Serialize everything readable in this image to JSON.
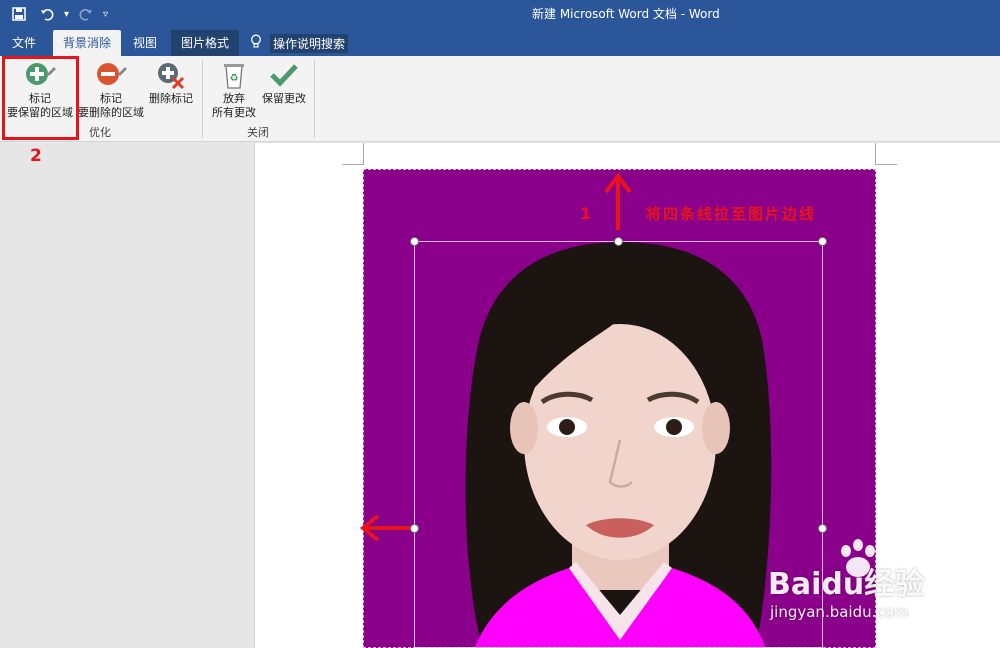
{
  "window": {
    "title": "新建 Microsoft Word 文档  -  Word"
  },
  "quick_access": [
    {
      "name": "save-icon",
      "glyph": "■"
    },
    {
      "name": "undo-icon",
      "glyph": "↶"
    },
    {
      "name": "redo-icon",
      "glyph": "↻"
    },
    {
      "name": "customize-icon",
      "glyph": "▾"
    }
  ],
  "tabs": {
    "file": "文件",
    "background_removal": "背景消除",
    "view": "视图",
    "picture_format": "图片格式"
  },
  "tell_me": {
    "label": "操作说明搜索"
  },
  "ribbon": {
    "keep_line1": "标记",
    "keep_line2": "要保留的区域",
    "remove_line1": "标记",
    "remove_line2": "要删除的区域",
    "delete_mark": "删除标记",
    "discard_line1": "放弃",
    "discard_line2": "所有更改",
    "keep_changes": "保留更改",
    "group_refine": "优化",
    "group_close": "关闭"
  },
  "annotations": {
    "step_2": "2",
    "step_1": "1",
    "instruction": "将四条线拉至图片边线"
  },
  "watermark": {
    "brand": "Baidu经验",
    "url": "jingyan.baidu.com"
  },
  "colors": {
    "brand_blue": "#2b579a",
    "annotation_red": "#e8141b",
    "photo_background": "#8b008b",
    "shirt": "#ff00ff"
  }
}
